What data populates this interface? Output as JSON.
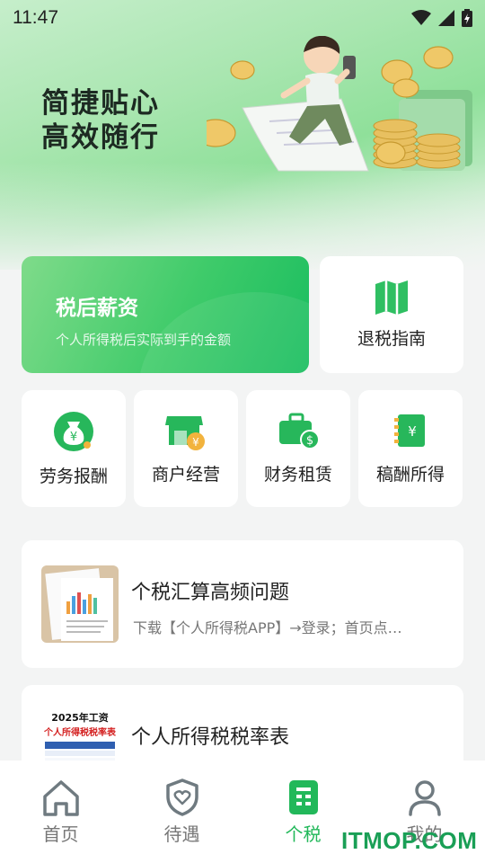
{
  "status_bar": {
    "time": "11:47"
  },
  "hero": {
    "slogan_line1": "简捷贴心",
    "slogan_line2": "高效随行"
  },
  "cards": {
    "salary": {
      "title": "税后薪资",
      "subtitle": "个人所得税后实际到手的金额"
    },
    "refund": {
      "label": "退税指南"
    }
  },
  "tiles": [
    {
      "label": "劳务报酬",
      "icon": "money-bag-icon"
    },
    {
      "label": "商户经营",
      "icon": "shop-icon"
    },
    {
      "label": "财务租赁",
      "icon": "briefcase-dollar-icon"
    },
    {
      "label": "稿酬所得",
      "icon": "notebook-yen-icon"
    }
  ],
  "articles": [
    {
      "title": "个税汇算高频问题",
      "desc": "下载【个人所得税APP】→登录；首页点…"
    },
    {
      "title": "个人所得税税率表",
      "desc": "",
      "thumb_heading1": "2025年工资",
      "thumb_heading2": "个人所得税税率表"
    }
  ],
  "tabbar": {
    "items": [
      {
        "label": "首页",
        "icon": "home-icon"
      },
      {
        "label": "待遇",
        "icon": "shield-heart-icon"
      },
      {
        "label": "个税",
        "icon": "tax-document-icon",
        "active": true
      },
      {
        "label": "我的",
        "icon": "user-icon"
      }
    ]
  },
  "watermark": "ITMOP.COM",
  "colors": {
    "accent": "#22b85a",
    "accent_dark": "#19bd5f",
    "text": "#222222",
    "muted": "#777777"
  }
}
